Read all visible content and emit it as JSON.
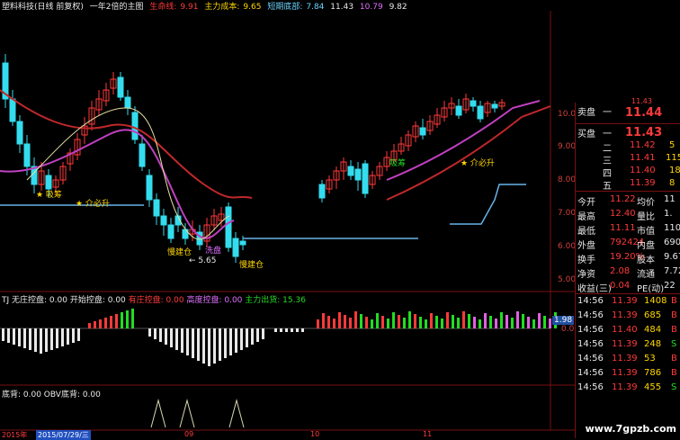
{
  "top_bar": {
    "title": "塑料科技(日线 前复权)",
    "formula": "一年2倍的主图",
    "lifeline_label": "生命线:",
    "lifeline_value": "9.91",
    "main_cost_label": "主力成本:",
    "main_cost_value": "9.65",
    "short_bottom_label": "短期底部:",
    "short_bottom_value": "7.84",
    "extra_value_1": "11.43",
    "extra_value_2": "10.79",
    "extra_value_3": "9.82"
  },
  "chart_annotations": {
    "signal_a": "★ 吸筹",
    "signal_b": "★ 介必升",
    "signal_c": "吸筹",
    "signal_d": "★ 介必升",
    "build_1": "慢建仓",
    "build_2": "慢建仓",
    "build_3": "慢建仓",
    "wash": "洗盘",
    "low_price": "← 5.65",
    "ship": "出货"
  },
  "price_axis": [
    "10.00",
    "9.00",
    "8.00",
    "7.00",
    "6.00",
    "5.00"
  ],
  "indicator_bar": {
    "name": "TJ",
    "no_control": "无庄控盘: 0.00",
    "start_control": "开始控盘: 0.00",
    "has_control": "有庄控盘: 0.00",
    "high_control": "高度控盘: 0.00",
    "main_ship": "主力出货: 15.36"
  },
  "indicator_axis": [
    "1.98",
    "0.00"
  ],
  "bottom_indicator": {
    "name": "底背",
    "label": ": 0.00  OBV底背: 0.00"
  },
  "date_axis": {
    "left": "2015年",
    "highlight": "2015/07/29/三",
    "m1": "09",
    "m2": "10",
    "m3": "11"
  },
  "side_panel": {
    "sell_label": "卖盘",
    "sell_level": "一",
    "sell_price": "11.44",
    "sell_prev": "11.43",
    "buy_label": "买盘",
    "buy_level": "一",
    "buy_price": "11.43",
    "book": [
      {
        "level": "二",
        "price": "11.42",
        "vol": "5"
      },
      {
        "level": "三",
        "price": "11.41",
        "vol": "115"
      },
      {
        "level": "四",
        "price": "11.40",
        "vol": "18"
      },
      {
        "level": "五",
        "price": "11.39",
        "vol": "8"
      }
    ],
    "stats": [
      {
        "l1": "今开",
        "v1": "11.22",
        "l2": "均价",
        "v2": "11"
      },
      {
        "l1": "最高",
        "v1": "12.40",
        "l2": "量比",
        "v2": "1."
      },
      {
        "l1": "最低",
        "v1": "11.11",
        "l2": "市值",
        "v2": "110.8"
      },
      {
        "l1": "外盘",
        "v1": "792424",
        "l2": "内盘",
        "v2": "6904"
      },
      {
        "l1": "换手",
        "v1": "19.20%",
        "l2": "股本",
        "v2": "9.67"
      },
      {
        "l1": "净资",
        "v1": "2.08",
        "l2": "流通",
        "v2": "7.72"
      },
      {
        "l1": "收益(三)",
        "v1": "0.04",
        "l2": "PE(动)",
        "v2": "22"
      }
    ],
    "ticks": [
      {
        "time": "14:56",
        "price": "11.39",
        "vol": "1408",
        "side": "B"
      },
      {
        "time": "14:56",
        "price": "11.39",
        "vol": "685",
        "side": "B"
      },
      {
        "time": "14:56",
        "price": "11.40",
        "vol": "484",
        "side": "B"
      },
      {
        "time": "14:56",
        "price": "11.39",
        "vol": "248",
        "side": "S"
      },
      {
        "time": "14:56",
        "price": "11.39",
        "vol": "53",
        "side": "B"
      },
      {
        "time": "14:56",
        "price": "11.39",
        "vol": "786",
        "side": "B"
      },
      {
        "time": "14:56",
        "price": "11.39",
        "vol": "455",
        "side": "S"
      }
    ]
  },
  "watermark": "www.7gpzb.com",
  "colors": {
    "up": "#ff3a3a",
    "down": "#33ddee",
    "lifeline": "#c0282a",
    "magenta_ma": "#c040c0",
    "yellow_ma": "#e8e0a0",
    "bottom_line": "#68b4e8",
    "grid": "#7a1010"
  }
}
